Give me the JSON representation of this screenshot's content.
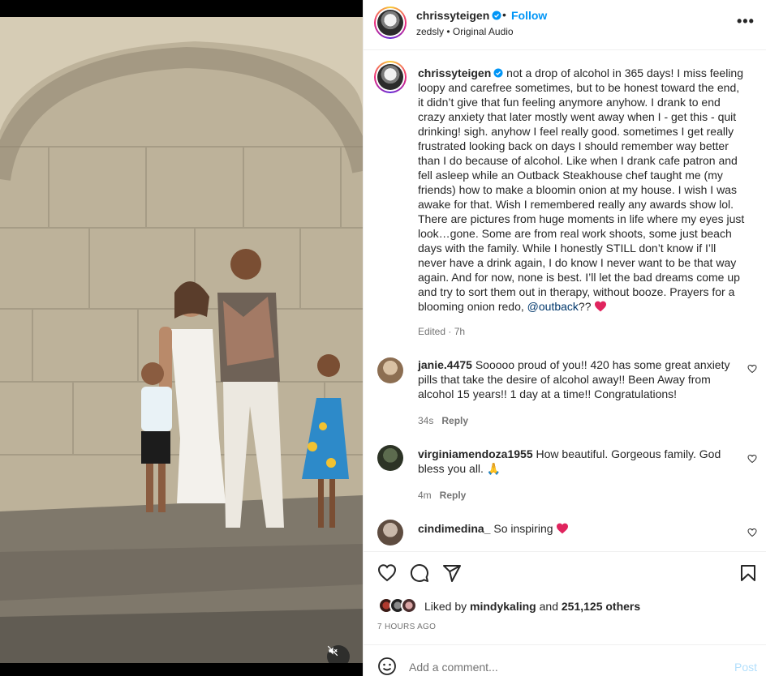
{
  "header": {
    "username": "chrissyteigen",
    "dot": "•",
    "follow_label": "Follow",
    "audio_owner": "zedsly",
    "audio_sep": " • ",
    "audio_label": "Original Audio",
    "more_label": "•••"
  },
  "caption": {
    "username": "chrissyteigen",
    "text": " not a drop of alcohol in 365 days! I miss feeling loopy and carefree sometimes, but to be honest toward the end, it didn’t give that fun feeling anymore anyhow. I drank to end crazy anxiety that later mostly went away when I - get this - quit drinking! sigh. anyhow I feel really good. sometimes I get really frustrated looking back on days I should remember way better than I do because of alcohol. Like when I drank cafe patron and fell asleep while an Outback Steakhouse chef taught me (my friends) how to make a bloomin onion at my house. I wish I was awake for that. Wish I remembered really any awards show lol. There are pictures from huge moments in life where my eyes just look…gone. Some are from real work shoots, some just beach days with the family. While I honestly STILL don’t know if I’ll never have a drink again, I do know I never want to be that way again. And for now, none is best. I’ll let the bad dreams come up and try to sort them out in therapy, without booze. Prayers for a blooming onion redo, ",
    "mention": "@outback",
    "suffix": "?? ",
    "edited": "Edited · 7h"
  },
  "comments": [
    {
      "username": "janie.4475",
      "text": " Sooooo proud of you!! 420 has some great anxiety pills that take the desire of alcohol away!! Been Away from alcohol 15 years!! 1 day at a time!! Congratulations!",
      "time": "34s",
      "reply_label": "Reply"
    },
    {
      "username": "virginiamendoza1955",
      "text": " How beautiful. Gorgeous family. God bless you all. 🙏",
      "time": "4m",
      "reply_label": "Reply"
    },
    {
      "username": "cindimedina_",
      "text": " So inspiring ",
      "time": "",
      "reply_label": ""
    }
  ],
  "likes": {
    "prefix": "Liked by ",
    "liker": "mindykaling",
    "and": " and ",
    "count": "251,125 others"
  },
  "time_ago": "7 HOURS AGO",
  "add_comment": {
    "placeholder": "Add a comment...",
    "post_label": "Post"
  },
  "icons": [
    "verified-badge-icon",
    "more-options-icon",
    "heart-icon",
    "comment-icon",
    "share-icon",
    "bookmark-icon",
    "emoji-icon",
    "mute-icon"
  ],
  "colors": {
    "accent": "#0095f6",
    "heart": "#ed4956",
    "mention": "#00376b",
    "post_disabled": "#b2dffc"
  }
}
